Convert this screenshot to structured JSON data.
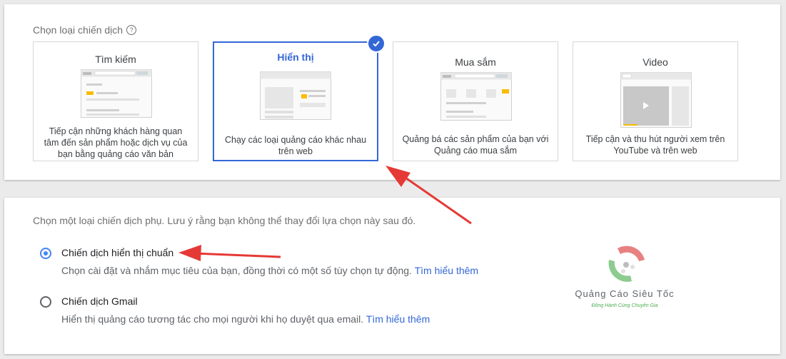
{
  "campaign_type": {
    "title": "Chọn loại chiến dịch",
    "help_icon": "help-circle-icon",
    "cards": [
      {
        "title": "Tìm kiếm",
        "description": "Tiếp cận những khách hàng quan tâm đến sản phẩm hoặc dịch vụ của bạn bằng quảng cáo văn bản",
        "selected": false
      },
      {
        "title": "Hiển thị",
        "description": "Chạy các loại quảng cáo khác nhau trên web",
        "selected": true
      },
      {
        "title": "Mua sắm",
        "description": "Quảng bá các sản phẩm của bạn với Quảng cáo mua sắm",
        "selected": false
      },
      {
        "title": "Video",
        "description": "Tiếp cận và thu hút người xem trên YouTube và trên web",
        "selected": false
      }
    ]
  },
  "subtype": {
    "title": "Chọn một loại chiến dịch phụ. Lưu ý rằng bạn không thể thay đổi lựa chọn này sau đó.",
    "options": [
      {
        "label": "Chiến dịch hiển thị chuẩn",
        "description": "Chọn cài đặt và nhắm mục tiêu của bạn, đồng thời có một số tùy chọn tự động.",
        "link": "Tìm hiểu thêm",
        "selected": true
      },
      {
        "label": "Chiến dịch Gmail",
        "description": "Hiển thị quảng cáo tương tác cho mọi người khi họ duyệt qua email.",
        "link": "Tìm hiểu thêm",
        "selected": false
      }
    ]
  },
  "watermark": {
    "name": "Quảng Cáo Siêu Tốc",
    "tagline": "Đồng Hành Cùng Chuyên Gia"
  },
  "colors": {
    "accent": "#3367d6",
    "radio": "#4285f4",
    "annotation_arrow": "#e53935",
    "illustration_highlight": "#fbbc04"
  }
}
